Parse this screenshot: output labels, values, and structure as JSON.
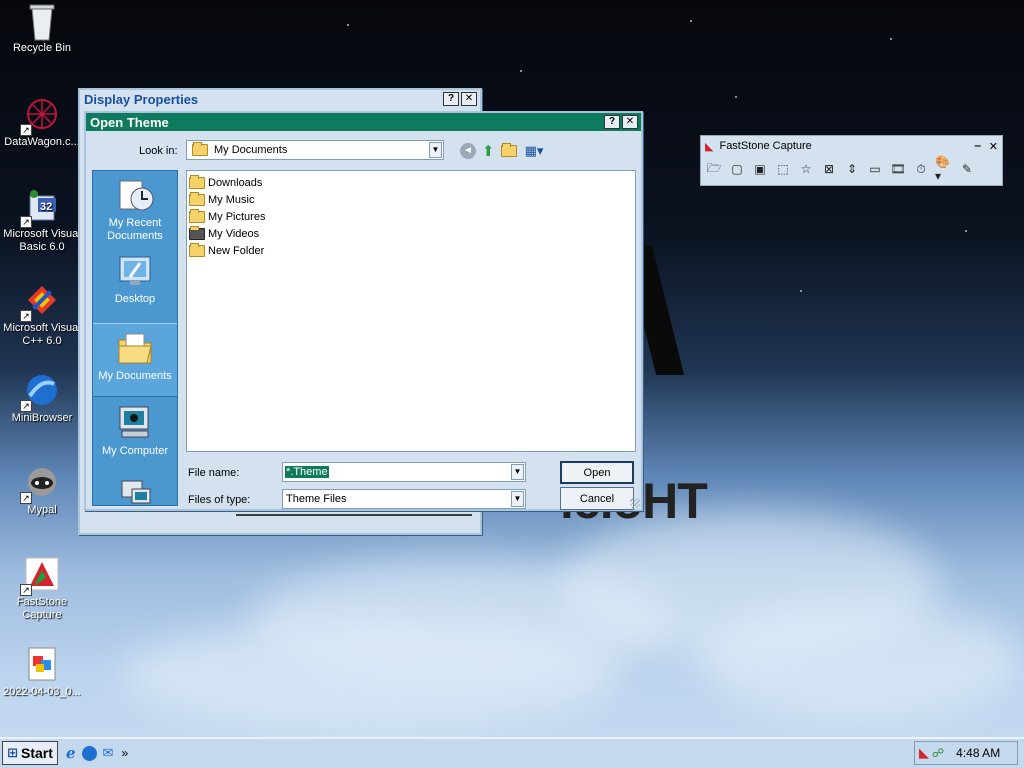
{
  "desktop": {
    "icons": [
      {
        "label": "Recycle Bin"
      },
      {
        "label": "DataWagon.c..."
      },
      {
        "label": "Microsoft Visual Basic 6.0"
      },
      {
        "label": "Microsoft Visual C++ 6.0"
      },
      {
        "label": "MiniBrowser"
      },
      {
        "label": "Mypal"
      },
      {
        "label": "FastStone Capture"
      },
      {
        "label": "2022-04-03_0..."
      }
    ],
    "badge_32": "32"
  },
  "display_properties": {
    "title": "Display Properties",
    "help_btn": "?",
    "close_btn": "✕"
  },
  "open_theme": {
    "title": "Open Theme",
    "help_btn": "?",
    "close_btn": "✕",
    "look_in_label": "Look in:",
    "look_in_value": "My Documents",
    "places": [
      {
        "label": "My Recent Documents"
      },
      {
        "label": "Desktop"
      },
      {
        "label": "My Documents"
      },
      {
        "label": "My Computer"
      }
    ],
    "files": [
      {
        "name": "Downloads"
      },
      {
        "name": "My Music"
      },
      {
        "name": "My Pictures"
      },
      {
        "name": "My Videos"
      },
      {
        "name": "New Folder"
      }
    ],
    "file_name_label": "File name:",
    "file_name_value": "*.Theme",
    "files_of_type_label": "Files of type:",
    "files_of_type_value": "Theme Files",
    "open_button": "Open",
    "cancel_button": "Cancel"
  },
  "faststone": {
    "title": "FastStone Capture",
    "minimize": "‒",
    "close": "✕"
  },
  "taskbar": {
    "start_label": "Start",
    "more": "»",
    "clock": "4:48 AM"
  },
  "colors": {
    "title_active": "#0e7a5e",
    "title_inactive": "#3a7bd5",
    "places_bar": "#4b98d1"
  }
}
